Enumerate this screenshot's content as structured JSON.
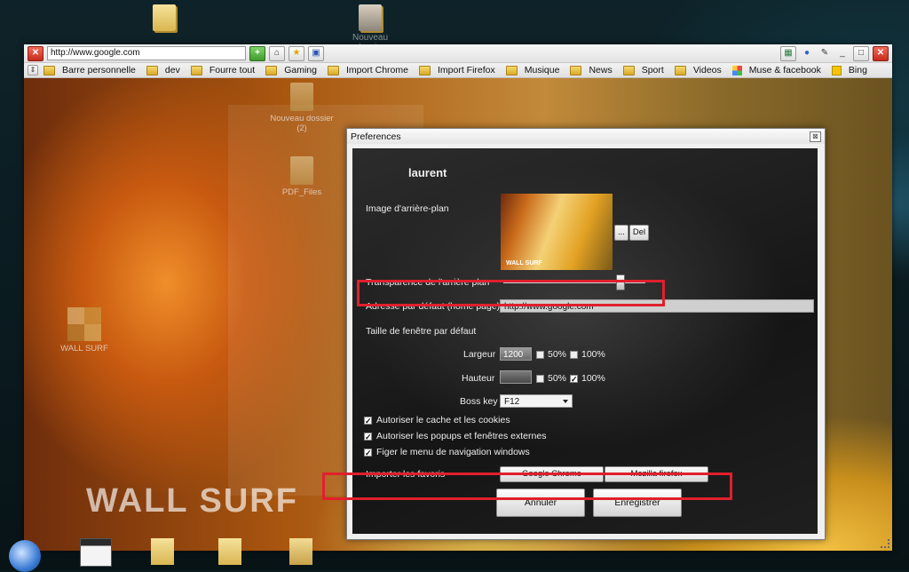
{
  "desktop": {
    "icons": [
      {
        "label": ""
      },
      {
        "label": "Nouveau dossier"
      }
    ]
  },
  "browser": {
    "url": "http://www.google.com",
    "bookmarks": [
      {
        "label": "Barre personnelle",
        "icon": "folder-icon"
      },
      {
        "label": "dev",
        "icon": "folder-icon"
      },
      {
        "label": "Fourre tout",
        "icon": "folder-icon"
      },
      {
        "label": "Gaming",
        "icon": "folder-icon"
      },
      {
        "label": "Import Chrome",
        "icon": "folder-icon"
      },
      {
        "label": "Import Firefox",
        "icon": "folder-icon"
      },
      {
        "label": "Musique",
        "icon": "folder-icon"
      },
      {
        "label": "News",
        "icon": "folder-icon"
      },
      {
        "label": "Sport",
        "icon": "folder-icon"
      },
      {
        "label": "Videos",
        "icon": "folder-icon"
      },
      {
        "label": "Muse & facebook",
        "icon": "grid-icon"
      },
      {
        "label": "Bing",
        "icon": "bing-icon"
      }
    ],
    "inner_desktop": {
      "folder1": "Nouveau dossier\n(2)",
      "folder2": "PDF_Files",
      "wallsurf_shortcut": "WALL SURF",
      "logo": "WALL SURF"
    }
  },
  "dialog": {
    "title": "Preferences",
    "user": "laurent",
    "background_label": "Image d'arrière-plan",
    "thumb_caption": "WALL SURF",
    "browse_btn": "...",
    "del_btn": "Del",
    "transparency_label": "Transparence de l'arrière plan",
    "transparency_value": 0.82,
    "home_label": "Adresse par défaut (home page)",
    "home_value": "http://www.google.com",
    "window_size_label": "Taille de fenêtre par défaut",
    "width_label": "Largeur",
    "width_value": "1200",
    "height_label": "Hauteur",
    "height_value": "",
    "pct50": "50%",
    "pct100": "100%",
    "width_50_checked": false,
    "width_100_checked": false,
    "height_50_checked": false,
    "height_100_checked": true,
    "boss_key_label": "Boss key",
    "boss_key_value": "F12",
    "opt_cache": "Autoriser le cache et les cookies",
    "opt_popups": "Autoriser les popups et fenêtres externes",
    "opt_menu": "Figer le menu de navigation windows",
    "import_label": "Importer les favoris",
    "import_chrome": "Google Chrome",
    "import_firefox": "Mozilla firefox",
    "cancel": "Annuler",
    "save": "Enregistrer"
  },
  "colors": {
    "highlight": "#e0202c",
    "panel": "#1f1f1f"
  }
}
